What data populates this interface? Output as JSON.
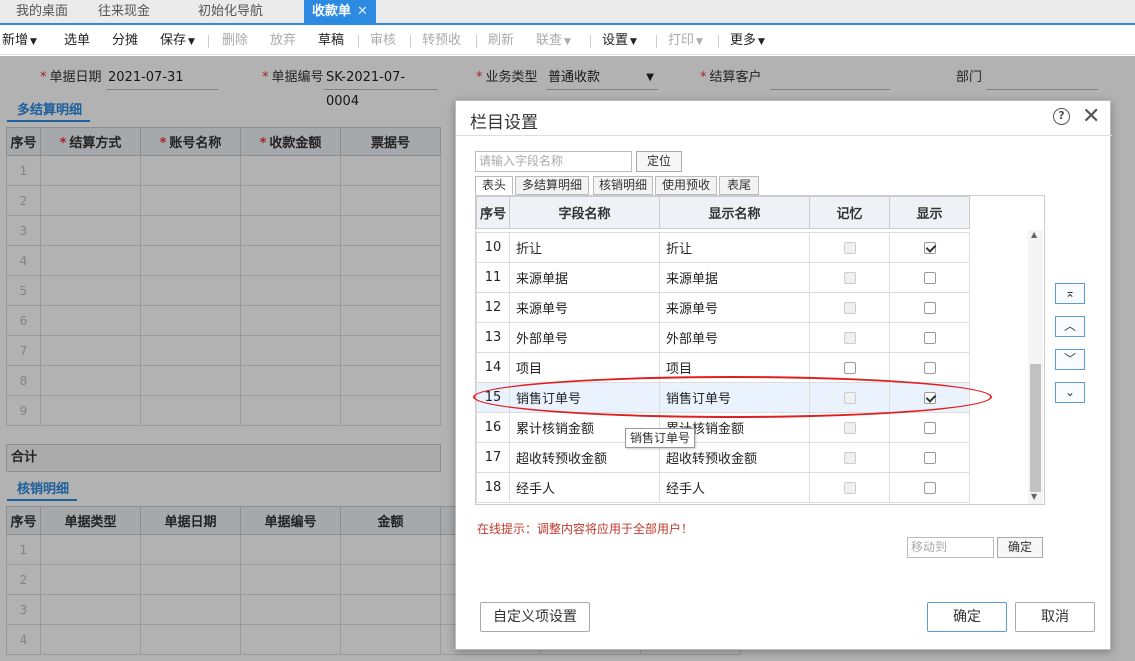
{
  "tabs": [
    {
      "label": "我的桌面",
      "active": false
    },
    {
      "label": "往来现金",
      "active": false
    },
    {
      "label": "初始化导航",
      "active": false
    },
    {
      "label": "收款单",
      "active": true
    }
  ],
  "toolbar": {
    "add": "新增",
    "select": "选单",
    "split": "分摊",
    "save": "保存",
    "delete": "删除",
    "abandon": "放弃",
    "draft": "草稿",
    "audit": "审核",
    "to_prepaid": "转预收",
    "refresh": "刷新",
    "link": "联查",
    "settings": "设置",
    "print": "打印",
    "more": "更多"
  },
  "form": {
    "date_label": "单据日期",
    "date_value": "2021-07-31",
    "no_label": "单据编号",
    "no_value": "SK-2021-07-0004",
    "biz_label": "业务类型",
    "biz_value": "普通收款",
    "customer_label": "结算客户",
    "customer_value": "",
    "dept_label": "部门",
    "dept_value": ""
  },
  "settle_section": {
    "title": "多结算明细",
    "columns": [
      "序号",
      "结算方式",
      "账号名称",
      "收款金额",
      "票据号"
    ],
    "required": [
      false,
      true,
      true,
      true,
      false
    ],
    "rows": [
      "1",
      "2",
      "3",
      "4",
      "5",
      "6",
      "7",
      "8",
      "9"
    ]
  },
  "sum_label": "合计",
  "verify_section": {
    "title": "核销明细",
    "columns": [
      "序号",
      "单据类型",
      "单据日期",
      "单据编号",
      "金额"
    ],
    "rows": [
      "1",
      "2",
      "3",
      "4"
    ]
  },
  "dialog": {
    "title": "栏目设置",
    "help_icon": "?",
    "close_icon": "✕",
    "search_placeholder": "请输入字段名称",
    "locate_btn": "定位",
    "subtabs": [
      "表头",
      "多结算明细",
      "核销明细",
      "使用预收",
      "表尾"
    ],
    "columns": [
      "序号",
      "字段名称",
      "显示名称",
      "记忆",
      "显示"
    ],
    "rows": [
      {
        "no": "10",
        "field": "折让",
        "display": "折让",
        "remember_enabled": false,
        "show": true
      },
      {
        "no": "11",
        "field": "来源单据",
        "display": "来源单据",
        "remember_enabled": false,
        "show": false
      },
      {
        "no": "12",
        "field": "来源单号",
        "display": "来源单号",
        "remember_enabled": false,
        "show": false
      },
      {
        "no": "13",
        "field": "外部单号",
        "display": "外部单号",
        "remember_enabled": false,
        "show": false
      },
      {
        "no": "14",
        "field": "项目",
        "display": "项目",
        "remember_enabled": true,
        "show": false
      },
      {
        "no": "15",
        "field": "销售订单号",
        "display": "销售订单号",
        "remember_enabled": false,
        "show": true
      },
      {
        "no": "16",
        "field": "累计核销金额",
        "display": "累计核销金额",
        "remember_enabled": false,
        "show": false
      },
      {
        "no": "17",
        "field": "超收转预收金额",
        "display": "超收转预收金额",
        "remember_enabled": false,
        "show": false
      },
      {
        "no": "18",
        "field": "经手人",
        "display": "经手人",
        "remember_enabled": false,
        "show": false
      }
    ],
    "hint": "在线提示：调整内容将应用于全部用户！",
    "moveto_placeholder": "移动到",
    "moveto_ok": "确定",
    "custom_btn": "自定义项设置",
    "ok_btn": "确定",
    "cancel_btn": "取消",
    "tooltip": "销售订单号"
  },
  "colors": {
    "accent": "#2c8ae0",
    "highlight": "#e02020",
    "hint": "#c0392b"
  }
}
